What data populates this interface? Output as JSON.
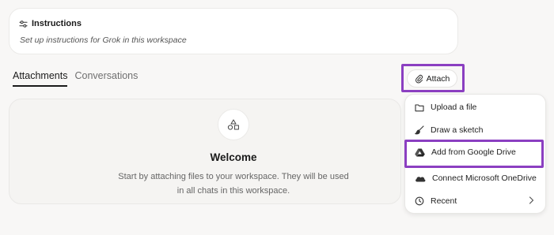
{
  "instructions": {
    "title": "Instructions",
    "subtitle": "Set up instructions for Grok in this workspace",
    "icon": "sliders-icon"
  },
  "tabs": [
    {
      "label": "Attachments",
      "active": true
    },
    {
      "label": "Conversations",
      "active": false
    }
  ],
  "attach": {
    "label": "Attach",
    "icon": "paperclip-icon"
  },
  "welcome": {
    "title": "Welcome",
    "text_line1": "Start by attaching files to your workspace. They will be used",
    "text_line2": "in all chats in this workspace.",
    "icon": "shapes-icon"
  },
  "menu": {
    "items": [
      {
        "label": "Upload a file",
        "icon": "folder-icon"
      },
      {
        "label": "Draw a sketch",
        "icon": "paintbrush-icon"
      },
      {
        "label": "Add from Google Drive",
        "icon": "google-drive-icon"
      },
      {
        "label": "Connect Microsoft OneDrive",
        "icon": "onedrive-icon"
      },
      {
        "label": "Recent",
        "icon": "clock-icon",
        "has_submenu": true
      }
    ]
  },
  "colors": {
    "highlight": "#8b3fc1",
    "background": "#f8f7f6"
  }
}
